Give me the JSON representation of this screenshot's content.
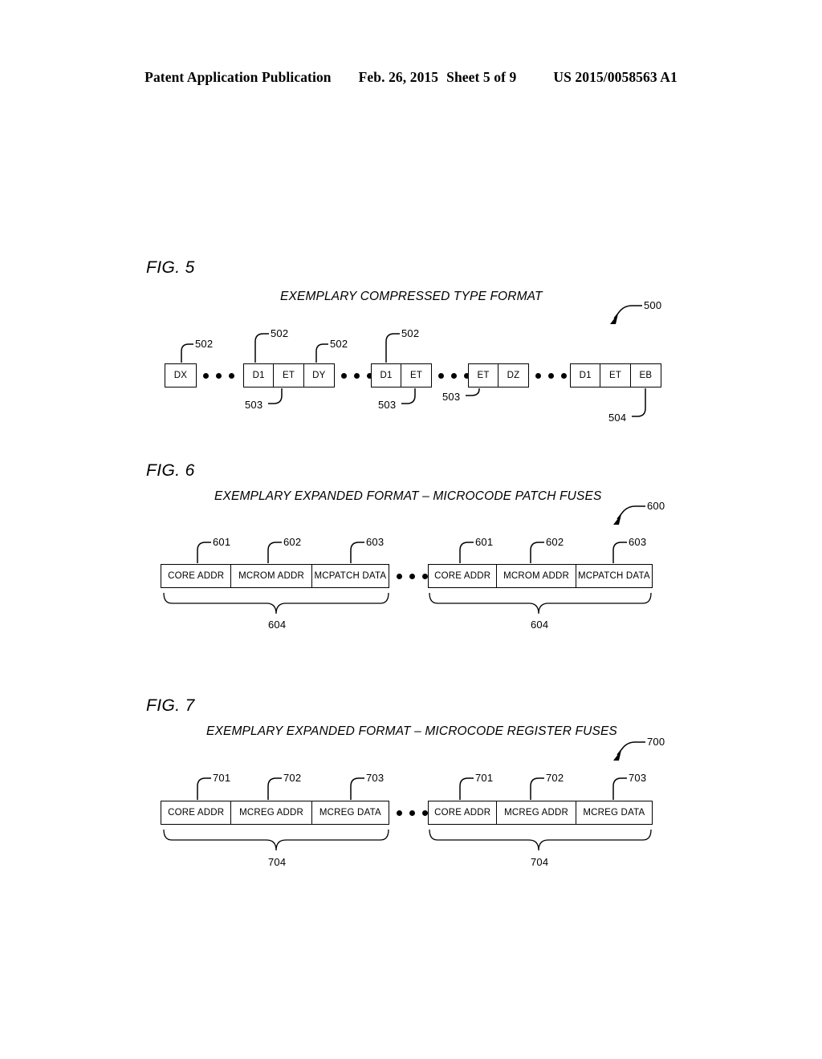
{
  "header": {
    "publication": "Patent Application Publication",
    "date": "Feb. 26, 2015",
    "sheet": "Sheet 5 of 9",
    "patent_number": "US 2015/0058563 A1"
  },
  "figures": [
    {
      "label": "FIG. 5",
      "title": "EXEMPLARY COMPRESSED TYPE FORMAT",
      "ref": "500",
      "groups": [
        {
          "cells": [
            "DX"
          ]
        },
        {
          "cells": [
            "D1",
            "ET",
            "DY"
          ]
        },
        {
          "cells": [
            "D1",
            "ET"
          ]
        },
        {
          "cells": [
            "ET",
            "DZ"
          ]
        },
        {
          "cells": [
            "D1",
            "ET",
            "EB"
          ]
        }
      ],
      "top_refs": [
        "502",
        "502",
        "502",
        "502"
      ],
      "bottom_refs": [
        "503",
        "503",
        "503",
        "504"
      ],
      "ellipsis": "●●●"
    },
    {
      "label": "FIG. 6",
      "title": "EXEMPLARY EXPANDED FORMAT – MICROCODE PATCH FUSES",
      "ref": "600",
      "groups": [
        {
          "cells": [
            "CORE ADDR",
            "MCROM ADDR",
            "MCPATCH DATA"
          ]
        },
        {
          "cells": [
            "CORE ADDR",
            "MCROM ADDR",
            "MCPATCH DATA"
          ]
        }
      ],
      "top_refs": [
        "601",
        "602",
        "603",
        "601",
        "602",
        "603"
      ],
      "brace_refs": [
        "604",
        "604"
      ],
      "ellipsis": "●●●"
    },
    {
      "label": "FIG. 7",
      "title": "EXEMPLARY EXPANDED FORMAT – MICROCODE REGISTER FUSES",
      "ref": "700",
      "groups": [
        {
          "cells": [
            "CORE ADDR",
            "MCREG ADDR",
            "MCREG DATA"
          ]
        },
        {
          "cells": [
            "CORE ADDR",
            "MCREG ADDR",
            "MCREG DATA"
          ]
        }
      ],
      "top_refs": [
        "701",
        "702",
        "703",
        "701",
        "702",
        "703"
      ],
      "brace_refs": [
        "704",
        "704"
      ],
      "ellipsis": "●●●"
    }
  ],
  "colors": {
    "ink": "#000000",
    "page": "#ffffff"
  }
}
